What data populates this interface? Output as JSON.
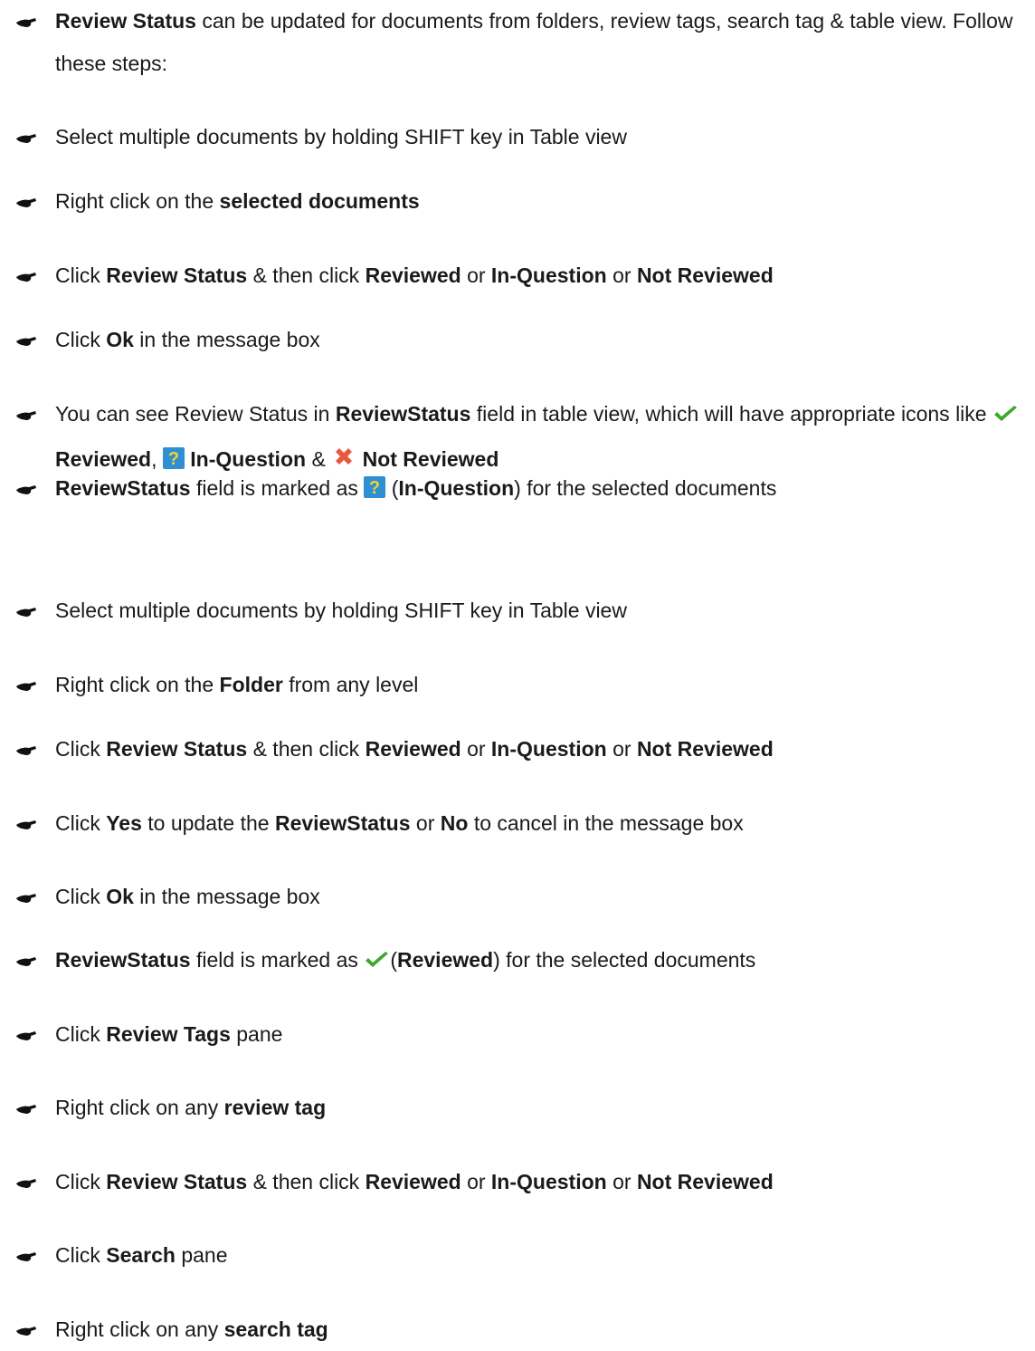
{
  "colors": {
    "text": "#1a1a1a",
    "bullet": "#111111",
    "check_icon": "#3fa82c",
    "question_icon_bg": "#2f8fd3",
    "question_icon_fg": "#f5d033",
    "cross_icon": "#e8573f"
  },
  "bullet_icon": "pointing-hand-icon",
  "steps": [
    {
      "segments": [
        {
          "t": "Review Status",
          "b": true
        },
        {
          "t": " can be updated for documents from folders, review tags, search tag & table view. Follow these steps:"
        }
      ]
    },
    {
      "segments": [
        {
          "t": "Select multiple documents by holding SHIFT key in Table view"
        }
      ]
    },
    {
      "segments": [
        {
          "t": "Right click on the "
        },
        {
          "t": "selected documents",
          "b": true
        }
      ]
    },
    {
      "segments": [
        {
          "t": "Click "
        },
        {
          "t": "Review Status",
          "b": true
        },
        {
          "t": " & then click "
        },
        {
          "t": "Reviewed",
          "b": true
        },
        {
          "t": " or "
        },
        {
          "t": "In-Question",
          "b": true
        },
        {
          "t": " or "
        },
        {
          "t": "Not Reviewed",
          "b": true
        }
      ]
    },
    {
      "segments": [
        {
          "t": "Click "
        },
        {
          "t": "Ok",
          "b": true
        },
        {
          "t": " in the message box"
        }
      ]
    },
    {
      "segments": [
        {
          "t": "You can see Review Status in "
        },
        {
          "t": "ReviewStatus",
          "b": true
        },
        {
          "t": " field in table view, which will have appropriate icons like "
        },
        {
          "icon": "check-icon"
        },
        {
          "t": " "
        },
        {
          "t": "Reviewed",
          "b": true
        },
        {
          "t": ",  "
        },
        {
          "icon": "question-icon"
        },
        {
          "t": " "
        },
        {
          "t": "In-Question",
          "b": true
        },
        {
          "t": " & "
        },
        {
          "icon": "cross-icon"
        },
        {
          "t": "  "
        },
        {
          "t": "Not Reviewed",
          "b": true
        }
      ]
    },
    {
      "segments": [
        {
          "t": "ReviewStatus",
          "b": true
        },
        {
          "t": " field is marked as "
        },
        {
          "icon": "question-icon"
        },
        {
          "t": " ("
        },
        {
          "t": "In-Question",
          "b": true
        },
        {
          "t": ") for the selected documents"
        }
      ]
    },
    {
      "segments": [
        {
          "t": "Select multiple documents by holding SHIFT key in Table view"
        }
      ]
    },
    {
      "segments": [
        {
          "t": "Right click on the "
        },
        {
          "t": "Folder",
          "b": true
        },
        {
          "t": " from any level"
        }
      ]
    },
    {
      "segments": [
        {
          "t": "Click "
        },
        {
          "t": "Review Status",
          "b": true
        },
        {
          "t": " & then click "
        },
        {
          "t": "Reviewed",
          "b": true
        },
        {
          "t": " or "
        },
        {
          "t": "In-Question",
          "b": true
        },
        {
          "t": " or "
        },
        {
          "t": "Not Reviewed",
          "b": true
        }
      ]
    },
    {
      "segments": [
        {
          "t": "Click "
        },
        {
          "t": "Yes",
          "b": true
        },
        {
          "t": " to update the "
        },
        {
          "t": "ReviewStatus",
          "b": true
        },
        {
          "t": " or "
        },
        {
          "t": "No",
          "b": true
        },
        {
          "t": " to cancel in the message box"
        }
      ]
    },
    {
      "segments": [
        {
          "t": "Click "
        },
        {
          "t": "Ok",
          "b": true
        },
        {
          "t": " in the message box"
        }
      ]
    },
    {
      "segments": [
        {
          "t": "ReviewStatus",
          "b": true
        },
        {
          "t": " field is marked as "
        },
        {
          "icon": "check-icon"
        },
        {
          "t": "("
        },
        {
          "t": "Reviewed",
          "b": true
        },
        {
          "t": ") for the selected documents"
        }
      ]
    },
    {
      "segments": [
        {
          "t": "Click "
        },
        {
          "t": "Review Tags",
          "b": true
        },
        {
          "t": " pane"
        }
      ]
    },
    {
      "segments": [
        {
          "t": "Right click on any "
        },
        {
          "t": "review tag",
          "b": true
        }
      ]
    },
    {
      "segments": [
        {
          "t": "Click "
        },
        {
          "t": "Review Status",
          "b": true
        },
        {
          "t": " & then click "
        },
        {
          "t": "Reviewed",
          "b": true
        },
        {
          "t": " or "
        },
        {
          "t": "In-Question",
          "b": true
        },
        {
          "t": " or "
        },
        {
          "t": "Not Reviewed",
          "b": true
        }
      ]
    },
    {
      "segments": [
        {
          "t": "Click "
        },
        {
          "t": "Search",
          "b": true
        },
        {
          "t": " pane"
        }
      ]
    },
    {
      "segments": [
        {
          "t": "Right click on any "
        },
        {
          "t": "search tag",
          "b": true
        }
      ]
    }
  ]
}
